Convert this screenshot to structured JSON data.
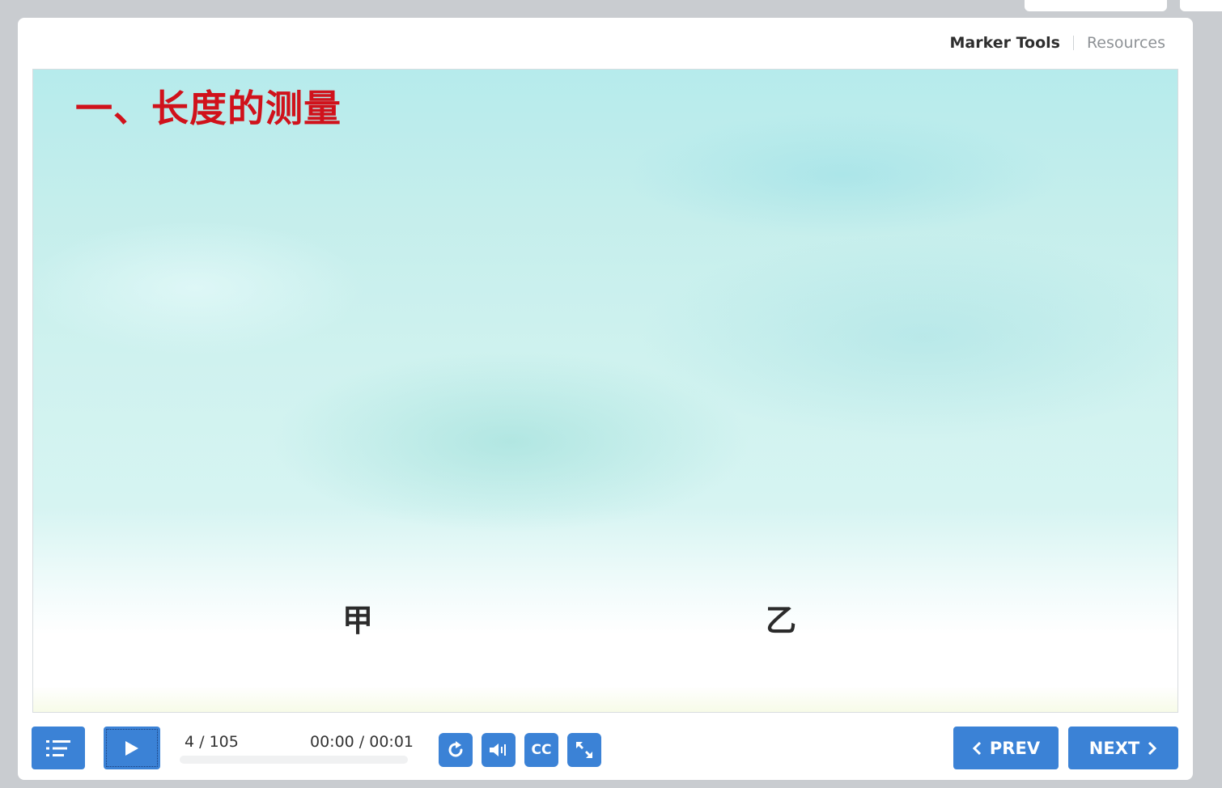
{
  "header": {
    "marker_tools": "Marker Tools",
    "resources": "Resources"
  },
  "slide": {
    "title": "一、长度的测量",
    "label_jia": "甲",
    "label_yi": "乙"
  },
  "controls": {
    "slide_counter": "4 / 105",
    "time": "00:00 / 00:01",
    "progress_percent": 0,
    "cc_label": "CC",
    "prev_label": "PREV",
    "next_label": "NEXT"
  },
  "icons": {
    "menu": "menu-list-icon",
    "play": "play-icon",
    "replay": "replay-icon",
    "volume": "volume-icon",
    "expand": "expand-icon",
    "prev": "chevron-left-icon",
    "next": "chevron-right-icon"
  },
  "colors": {
    "accent": "#3b82d6",
    "title_red": "#d0121b"
  }
}
